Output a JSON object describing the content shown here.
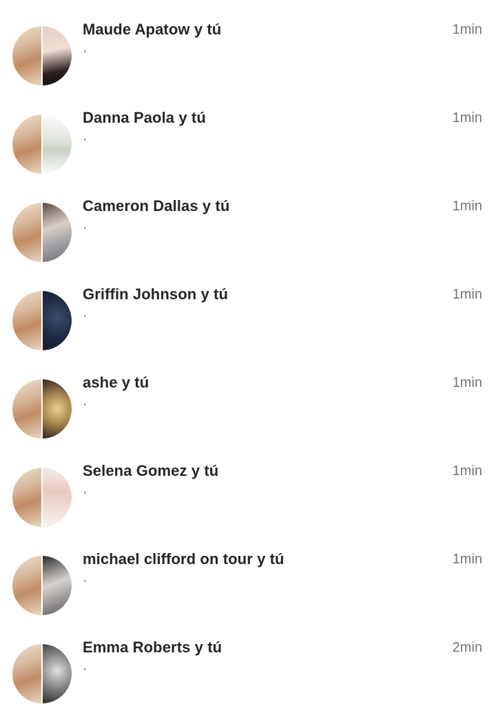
{
  "conversations": [
    {
      "name": "Maude Apatow y tú",
      "snippet": "·",
      "time": "1min",
      "avatar_right": "r-dark"
    },
    {
      "name": "Danna Paola y tú",
      "snippet": "·",
      "time": "1min",
      "avatar_right": "r-light"
    },
    {
      "name": "Cameron Dallas y tú",
      "snippet": "·",
      "time": "1min",
      "avatar_right": "r-gray"
    },
    {
      "name": "Griffin Johnson y tú",
      "snippet": "·",
      "time": "1min",
      "avatar_right": "r-navy"
    },
    {
      "name": "ashe y tú",
      "snippet": "·",
      "time": "1min",
      "avatar_right": "r-gold"
    },
    {
      "name": "Selena Gomez y tú",
      "snippet": "·",
      "time": "1min",
      "avatar_right": "r-pale"
    },
    {
      "name": "michael clifford on tour y tú",
      "snippet": "·",
      "time": "1min",
      "avatar_right": "r-mono"
    },
    {
      "name": "Emma Roberts y tú",
      "snippet": "·",
      "time": "2min",
      "avatar_right": "r-bw"
    }
  ]
}
